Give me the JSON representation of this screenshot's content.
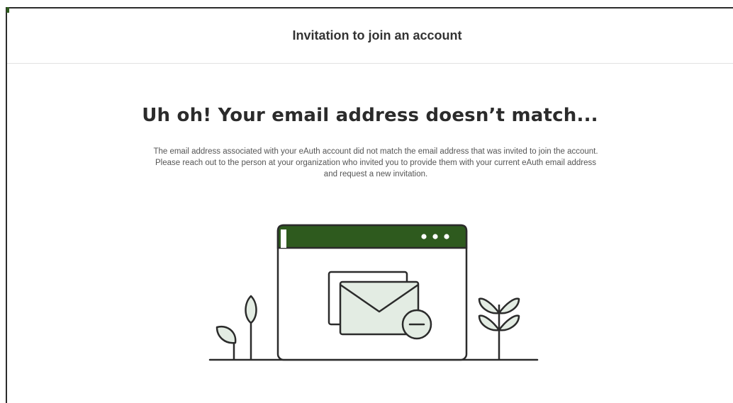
{
  "header": {
    "title": "Invitation to join an account"
  },
  "main": {
    "heading": "Uh oh! Your email address doesn’t match...",
    "message_lines": [
      "The email address associated with your eAuth account did not match the email address that was invited to join the account.",
      "Please reach out to the person at your organization who invited you to provide them with your current eAuth email address",
      "and request a new invitation."
    ]
  },
  "illustration": {
    "icon": "email-mismatch-illustration",
    "accent_color": "#2e5a1e",
    "fill_color": "#e3ece3",
    "stroke_color": "#2b2b2b"
  }
}
